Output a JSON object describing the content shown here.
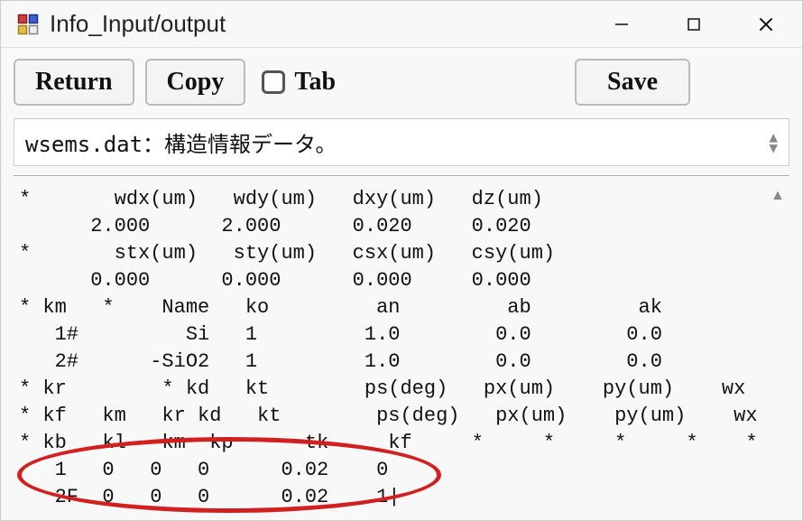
{
  "window": {
    "title": "Info_Input/output"
  },
  "toolbar": {
    "return_label": "Return",
    "copy_label": "Copy",
    "tab_label": "Tab",
    "save_label": "Save"
  },
  "header": {
    "text": "wsems.dat：構造情報データ。"
  },
  "content": {
    "lines": [
      "*       wdx(um)   wdy(um)   dxy(um)   dz(um)",
      "      2.000      2.000      0.020     0.020",
      "*       stx(um)   sty(um)   csx(um)   csy(um)",
      "      0.000      0.000      0.000     0.000",
      "* km   *    Name   ko         an         ab         ak",
      "   1#         Si   1         1.0        0.0        0.0",
      "   2#      -SiO2   1         1.0        0.0        0.0",
      "* kr        * kd   kt        ps(deg)   px(um)    py(um)    wx",
      "* kf   km   kr kd   kt        ps(deg)   px(um)    py(um)    wx",
      "* kb   kl   km  kp      tk     kf     *     *     *     *    *",
      "   1   0   0   0      0.02    0",
      "   2F  0   0   0      0.02    1|"
    ]
  }
}
